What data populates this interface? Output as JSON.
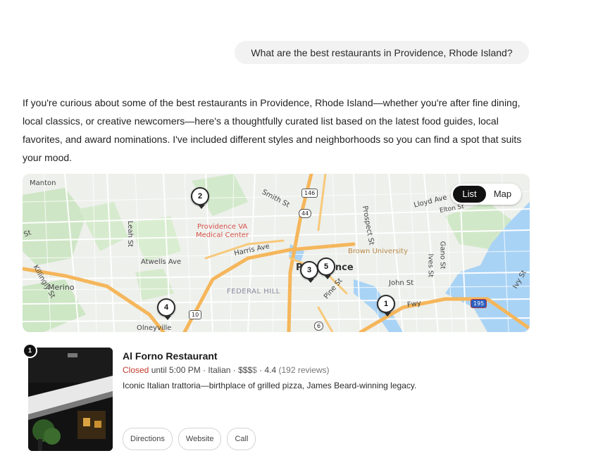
{
  "conversation": {
    "user_message": "What are the best restaurants in Providence, Rhode Island?",
    "intro": "If you're curious about some of the best restaurants in Providence, Rhode Island—whether you're after fine dining, local classics, or creative newcomers—here's a thoughtfully curated list based on the latest food guides, local favorites, and award nominations. I've included different styles and neighborhoods so you can find a spot that suits your mood."
  },
  "map": {
    "toggle": {
      "list_label": "List",
      "map_label": "Map",
      "active": "List"
    },
    "labels": {
      "manton": "Manton",
      "smith_st": "Smith St",
      "lloyd_ave": "Lloyd Ave",
      "elton_st": "Elton St",
      "providence_va": "Providence VA",
      "medical_center": "Medical Center",
      "leah_st": "Leah St",
      "prospect_st": "Prospect St",
      "brown_university": "Brown University",
      "harris_ave": "Harris Ave",
      "atwells_ave": "Atwells Ave",
      "gano_st": "Gano St",
      "ives_st": "Ives St",
      "providence": "Providence",
      "merino": "Merino",
      "federal_hill": "FEDERAL HILL",
      "pine_st": "Pine St",
      "john_st": "John St",
      "killingly_st": "Killingly St",
      "olneyville": "Olneyville",
      "ivy_st": "Ivy St",
      "freeway": "Fwy",
      "st_left": "St"
    },
    "shields": {
      "r146": "146",
      "r44": "44",
      "r10": "10",
      "r6": "6",
      "i195": "195"
    },
    "pins": [
      "1",
      "2",
      "3",
      "4",
      "5"
    ]
  },
  "results": [
    {
      "number": "1",
      "name": "Al Forno Restaurant",
      "status": "Closed",
      "status_rest": " until 5:00 PM · Italian · ",
      "price": "$$$",
      "price_muted": "$",
      "rating": " · 4.4",
      "reviews": " (192 reviews)",
      "description": "Iconic Italian trattoria—birthplace of grilled pizza, James Beard-winning legacy.",
      "actions": {
        "directions": "Directions",
        "website": "Website",
        "call": "Call"
      }
    }
  ],
  "colors": {
    "closed": "#c0392b",
    "highway": "#f5b65b",
    "water": "#a9d3f5",
    "park": "#cde8c4"
  }
}
